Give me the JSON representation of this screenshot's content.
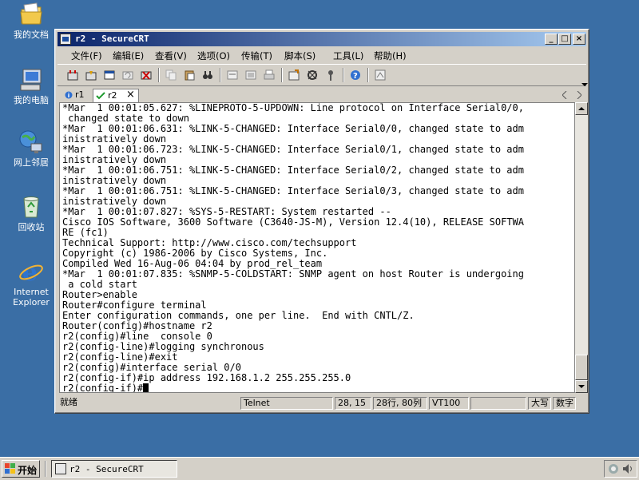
{
  "desktop": {
    "icons": [
      {
        "label": "我的文档",
        "icon": "my-documents-icon"
      },
      {
        "label": "我的电脑",
        "icon": "my-computer-icon"
      },
      {
        "label": "网上邻居",
        "icon": "network-places-icon"
      },
      {
        "label": "回收站",
        "icon": "recycle-bin-icon"
      },
      {
        "label_line1": "Internet",
        "label_line2": "Explorer",
        "icon": "internet-explorer-icon"
      }
    ]
  },
  "window": {
    "title": "r2 - SecureCRT",
    "controls": {
      "minimize": "_",
      "maximize": "□",
      "close": "×"
    },
    "menu": [
      "文件(F)",
      "编辑(E)",
      "查看(V)",
      "选项(O)",
      "传输(T)",
      "脚本(S)",
      "工具(L)",
      "帮助(H)"
    ],
    "tabs": [
      {
        "label": "r1",
        "active": false
      },
      {
        "label": "r2",
        "active": true,
        "close": "×"
      }
    ],
    "terminal_lines": [
      "*Mar  1 00:01:05.627: %LINEPROTO-5-UPDOWN: Line protocol on Interface Serial0/0,",
      " changed state to down",
      "*Mar  1 00:01:06.631: %LINK-5-CHANGED: Interface Serial0/0, changed state to adm",
      "inistratively down",
      "*Mar  1 00:01:06.723: %LINK-5-CHANGED: Interface Serial0/1, changed state to adm",
      "inistratively down",
      "*Mar  1 00:01:06.751: %LINK-5-CHANGED: Interface Serial0/2, changed state to adm",
      "inistratively down",
      "*Mar  1 00:01:06.751: %LINK-5-CHANGED: Interface Serial0/3, changed state to adm",
      "inistratively down",
      "*Mar  1 00:01:07.827: %SYS-5-RESTART: System restarted --",
      "Cisco IOS Software, 3600 Software (C3640-JS-M), Version 12.4(10), RELEASE SOFTWA",
      "RE (fc1)",
      "Technical Support: http://www.cisco.com/techsupport",
      "Copyright (c) 1986-2006 by Cisco Systems, Inc.",
      "Compiled Wed 16-Aug-06 04:04 by prod_rel_team",
      "*Mar  1 00:01:07.835: %SNMP-5-COLDSTART: SNMP agent on host Router is undergoing",
      " a cold start",
      "Router>enable",
      "Router#configure terminal",
      "Enter configuration commands, one per line.  End with CNTL/Z.",
      "Router(config)#hostname r2",
      "r2(config)#line  console 0",
      "r2(config-line)#logging synchronous",
      "r2(config-line)#exit",
      "r2(config)#interface serial 0/0",
      "r2(config-if)#ip address 192.168.1.2 255.255.255.0"
    ],
    "prompt": "r2(config-if)#",
    "status": {
      "ready": "就绪",
      "protocol": "Telnet",
      "position": "28, 15",
      "size": "28行, 80列",
      "emulation": "VT100",
      "empty": "",
      "caps": "大写",
      "num": "数字"
    }
  },
  "taskbar": {
    "start": "开始",
    "task_label": "r2 - SecureCRT"
  },
  "colors": {
    "desktop": "#3a6ea5",
    "titlebar_start": "#0a246a",
    "titlebar_end": "#a6caf0",
    "chrome": "#d4d0c8"
  }
}
